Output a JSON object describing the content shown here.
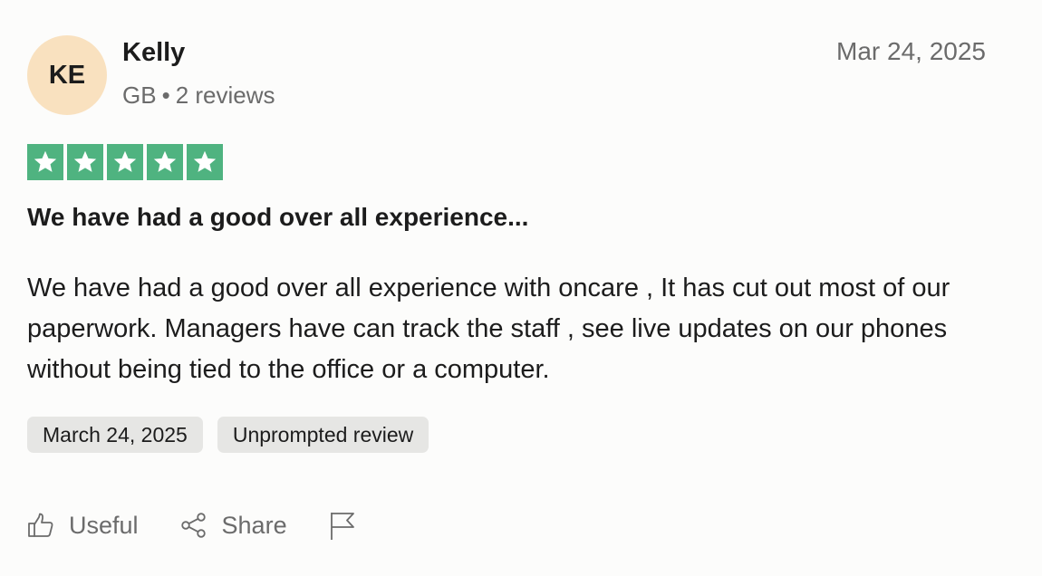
{
  "reviewer": {
    "initials": "KE",
    "name": "Kelly",
    "country": "GB",
    "separator": "•",
    "review_count": "2 reviews"
  },
  "review": {
    "date_top": "Mar 24, 2025",
    "rating": 5,
    "rating_max": 5,
    "title": "We have had a good over all experience...",
    "body": "We have had a good over all experience with oncare , It has cut out most of our paperwork. Managers have can track the staff , see live updates on our phones without being tied to the office or a computer.",
    "tags": {
      "date": "March 24, 2025",
      "type": "Unprompted review"
    }
  },
  "actions": {
    "useful_label": "Useful",
    "share_label": "Share",
    "useful_icon": "thumbs-up-icon",
    "share_icon": "share-icon",
    "report_icon": "flag-icon"
  },
  "colors": {
    "star_background": "#4fb380",
    "avatar_background": "#f9e1bf",
    "tag_background": "#e6e6e4",
    "muted_text": "#6b6b6b"
  }
}
